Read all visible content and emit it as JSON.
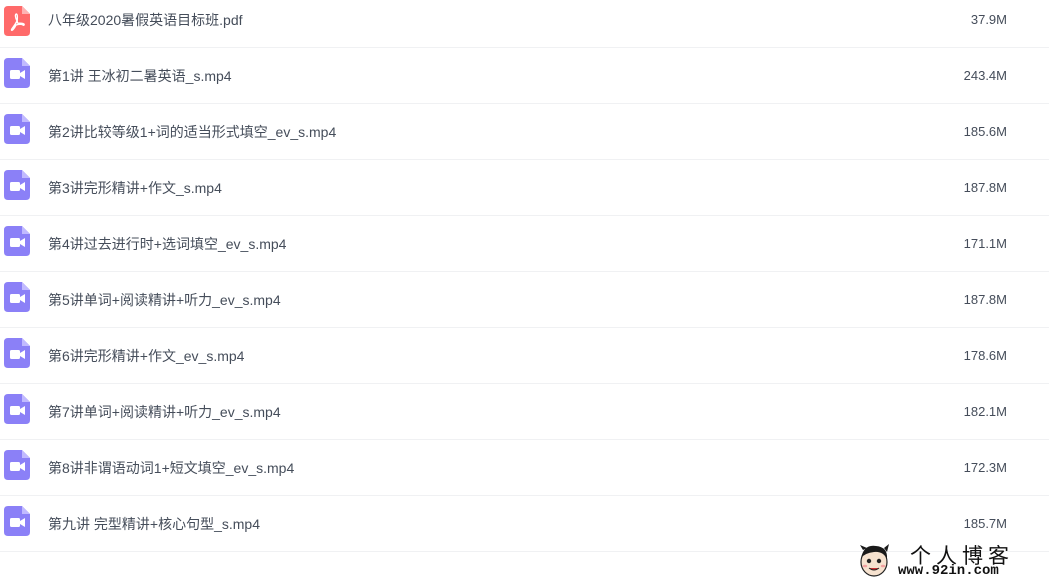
{
  "colors": {
    "pdf_icon": "#ff6a6a",
    "video_icon": "#8b80f7",
    "text": "#454d5a",
    "divider": "#f0f1f3"
  },
  "files": [
    {
      "icon": "pdf-icon",
      "name": "八年级2020暑假英语目标班.pdf",
      "size": "37.9M"
    },
    {
      "icon": "video-icon",
      "name": "第1讲 王冰初二暑英语_s.mp4",
      "size": "243.4M"
    },
    {
      "icon": "video-icon",
      "name": "第2讲比较等级1+词的适当形式填空_ev_s.mp4",
      "size": "185.6M"
    },
    {
      "icon": "video-icon",
      "name": "第3讲完形精讲+作文_s.mp4",
      "size": "187.8M"
    },
    {
      "icon": "video-icon",
      "name": "第4讲过去进行时+选词填空_ev_s.mp4",
      "size": "171.1M"
    },
    {
      "icon": "video-icon",
      "name": "第5讲单词+阅读精讲+听力_ev_s.mp4",
      "size": "187.8M"
    },
    {
      "icon": "video-icon",
      "name": "第6讲完形精讲+作文_ev_s.mp4",
      "size": "178.6M"
    },
    {
      "icon": "video-icon",
      "name": "第7讲单词+阅读精讲+听力_ev_s.mp4",
      "size": "182.1M"
    },
    {
      "icon": "video-icon",
      "name": "第8讲非谓语动词1+短文填空_ev_s.mp4",
      "size": "172.3M"
    },
    {
      "icon": "video-icon",
      "name": "第九讲 完型精讲+核心句型_s.mp4",
      "size": "185.7M"
    }
  ],
  "watermark": {
    "title": "个人博客",
    "url": "www.92in.com"
  }
}
